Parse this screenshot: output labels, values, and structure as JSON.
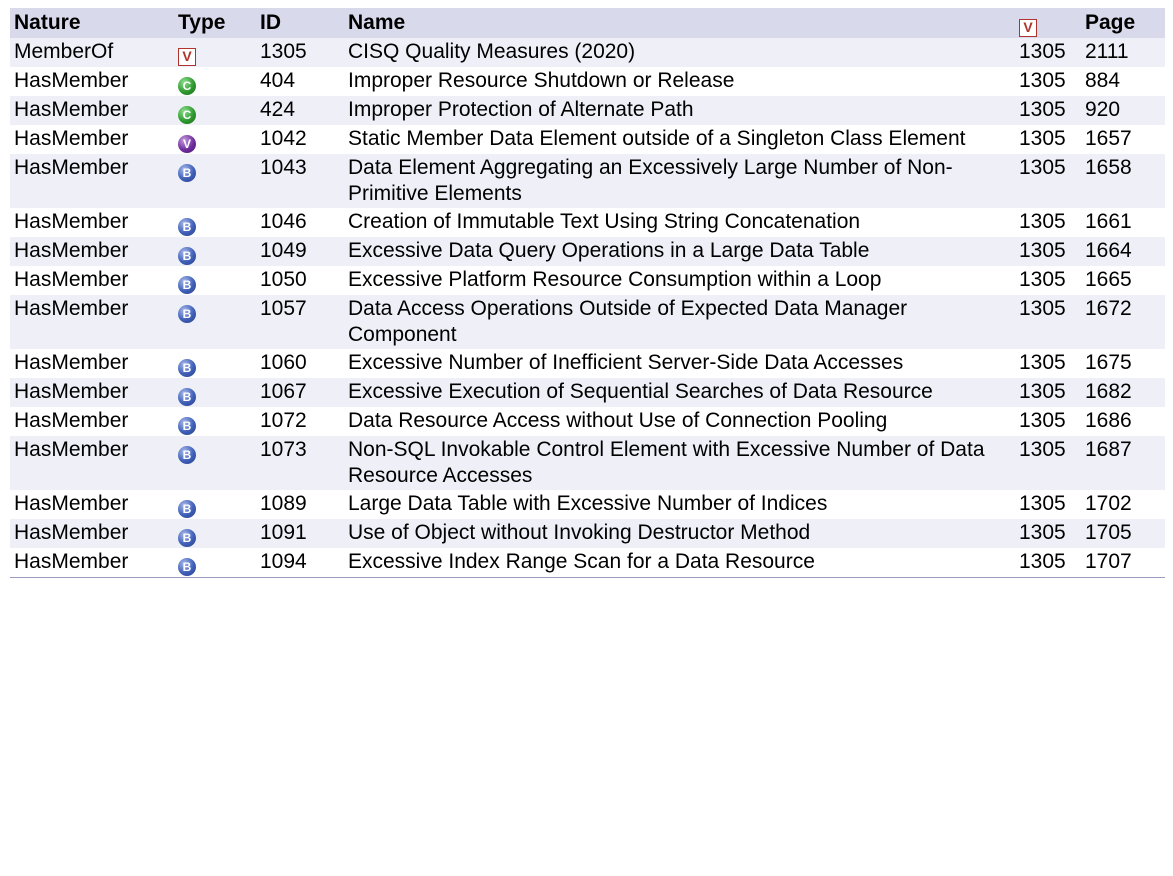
{
  "headers": {
    "nature": "Nature",
    "type": "Type",
    "id": "ID",
    "name": "Name",
    "view_icon": "V",
    "page": "Page"
  },
  "rows": [
    {
      "nature": "MemberOf",
      "type": "view",
      "type_glyph": "V",
      "id": "1305",
      "name": "CISQ Quality Measures (2020)",
      "view": "1305",
      "page": "2111"
    },
    {
      "nature": "HasMember",
      "type": "class",
      "type_glyph": "C",
      "id": "404",
      "name": "Improper Resource Shutdown or Release",
      "view": "1305",
      "page": "884"
    },
    {
      "nature": "HasMember",
      "type": "class",
      "type_glyph": "C",
      "id": "424",
      "name": "Improper Protection of Alternate Path",
      "view": "1305",
      "page": "920"
    },
    {
      "nature": "HasMember",
      "type": "variant",
      "type_glyph": "V",
      "id": "1042",
      "name": "Static Member Data Element outside of a Singleton Class Element",
      "view": "1305",
      "page": "1657"
    },
    {
      "nature": "HasMember",
      "type": "base",
      "type_glyph": "B",
      "id": "1043",
      "name": "Data Element Aggregating an Excessively Large Number of Non-Primitive Elements",
      "view": "1305",
      "page": "1658"
    },
    {
      "nature": "HasMember",
      "type": "base",
      "type_glyph": "B",
      "id": "1046",
      "name": "Creation of Immutable Text Using String Concatenation",
      "view": "1305",
      "page": "1661"
    },
    {
      "nature": "HasMember",
      "type": "base",
      "type_glyph": "B",
      "id": "1049",
      "name": "Excessive Data Query Operations in a Large Data Table",
      "view": "1305",
      "page": "1664"
    },
    {
      "nature": "HasMember",
      "type": "base",
      "type_glyph": "B",
      "id": "1050",
      "name": "Excessive Platform Resource Consumption within a Loop",
      "view": "1305",
      "page": "1665"
    },
    {
      "nature": "HasMember",
      "type": "base",
      "type_glyph": "B",
      "id": "1057",
      "name": "Data Access Operations Outside of Expected Data Manager Component",
      "view": "1305",
      "page": "1672"
    },
    {
      "nature": "HasMember",
      "type": "base",
      "type_glyph": "B",
      "id": "1060",
      "name": "Excessive Number of Inefficient Server-Side Data Accesses",
      "view": "1305",
      "page": "1675"
    },
    {
      "nature": "HasMember",
      "type": "base",
      "type_glyph": "B",
      "id": "1067",
      "name": "Excessive Execution of Sequential Searches of Data Resource",
      "view": "1305",
      "page": "1682"
    },
    {
      "nature": "HasMember",
      "type": "base",
      "type_glyph": "B",
      "id": "1072",
      "name": "Data Resource Access without Use of Connection Pooling",
      "view": "1305",
      "page": "1686"
    },
    {
      "nature": "HasMember",
      "type": "base",
      "type_glyph": "B",
      "id": "1073",
      "name": "Non-SQL Invokable Control Element with Excessive Number of Data Resource Accesses",
      "view": "1305",
      "page": "1687"
    },
    {
      "nature": "HasMember",
      "type": "base",
      "type_glyph": "B",
      "id": "1089",
      "name": "Large Data Table with Excessive Number of Indices",
      "view": "1305",
      "page": "1702"
    },
    {
      "nature": "HasMember",
      "type": "base",
      "type_glyph": "B",
      "id": "1091",
      "name": "Use of Object without Invoking Destructor Method",
      "view": "1305",
      "page": "1705"
    },
    {
      "nature": "HasMember",
      "type": "base",
      "type_glyph": "B",
      "id": "1094",
      "name": "Excessive Index Range Scan for a Data Resource",
      "view": "1305",
      "page": "1707"
    }
  ],
  "colors": {
    "header_bg": "#d9d9ec",
    "row_alt_bg": "#efeff8",
    "view_icon_red": "#b0342c",
    "class_icon_green": "#2f9a2f",
    "variant_icon_purple": "#6f2d9c",
    "base_icon_blue": "#3f5fb8"
  }
}
